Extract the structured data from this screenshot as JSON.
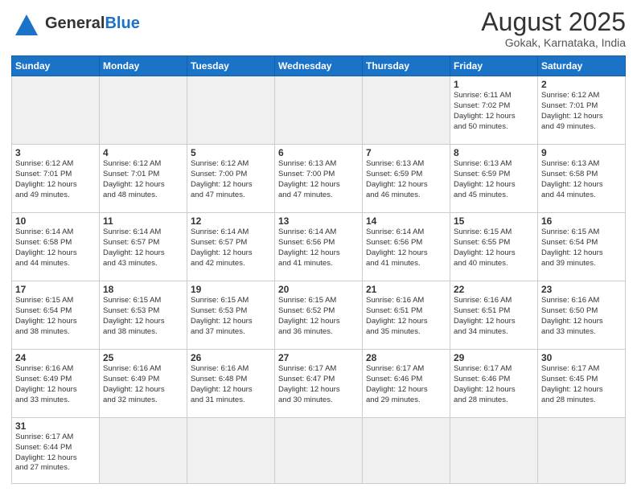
{
  "header": {
    "logo_general": "General",
    "logo_blue": "Blue",
    "title": "August 2025",
    "subtitle": "Gokak, Karnataka, India"
  },
  "weekdays": [
    "Sunday",
    "Monday",
    "Tuesday",
    "Wednesday",
    "Thursday",
    "Friday",
    "Saturday"
  ],
  "weeks": [
    [
      {
        "day": "",
        "info": ""
      },
      {
        "day": "",
        "info": ""
      },
      {
        "day": "",
        "info": ""
      },
      {
        "day": "",
        "info": ""
      },
      {
        "day": "",
        "info": ""
      },
      {
        "day": "1",
        "info": "Sunrise: 6:11 AM\nSunset: 7:02 PM\nDaylight: 12 hours\nand 50 minutes."
      },
      {
        "day": "2",
        "info": "Sunrise: 6:12 AM\nSunset: 7:01 PM\nDaylight: 12 hours\nand 49 minutes."
      }
    ],
    [
      {
        "day": "3",
        "info": "Sunrise: 6:12 AM\nSunset: 7:01 PM\nDaylight: 12 hours\nand 49 minutes."
      },
      {
        "day": "4",
        "info": "Sunrise: 6:12 AM\nSunset: 7:01 PM\nDaylight: 12 hours\nand 48 minutes."
      },
      {
        "day": "5",
        "info": "Sunrise: 6:12 AM\nSunset: 7:00 PM\nDaylight: 12 hours\nand 47 minutes."
      },
      {
        "day": "6",
        "info": "Sunrise: 6:13 AM\nSunset: 7:00 PM\nDaylight: 12 hours\nand 47 minutes."
      },
      {
        "day": "7",
        "info": "Sunrise: 6:13 AM\nSunset: 6:59 PM\nDaylight: 12 hours\nand 46 minutes."
      },
      {
        "day": "8",
        "info": "Sunrise: 6:13 AM\nSunset: 6:59 PM\nDaylight: 12 hours\nand 45 minutes."
      },
      {
        "day": "9",
        "info": "Sunrise: 6:13 AM\nSunset: 6:58 PM\nDaylight: 12 hours\nand 44 minutes."
      }
    ],
    [
      {
        "day": "10",
        "info": "Sunrise: 6:14 AM\nSunset: 6:58 PM\nDaylight: 12 hours\nand 44 minutes."
      },
      {
        "day": "11",
        "info": "Sunrise: 6:14 AM\nSunset: 6:57 PM\nDaylight: 12 hours\nand 43 minutes."
      },
      {
        "day": "12",
        "info": "Sunrise: 6:14 AM\nSunset: 6:57 PM\nDaylight: 12 hours\nand 42 minutes."
      },
      {
        "day": "13",
        "info": "Sunrise: 6:14 AM\nSunset: 6:56 PM\nDaylight: 12 hours\nand 41 minutes."
      },
      {
        "day": "14",
        "info": "Sunrise: 6:14 AM\nSunset: 6:56 PM\nDaylight: 12 hours\nand 41 minutes."
      },
      {
        "day": "15",
        "info": "Sunrise: 6:15 AM\nSunset: 6:55 PM\nDaylight: 12 hours\nand 40 minutes."
      },
      {
        "day": "16",
        "info": "Sunrise: 6:15 AM\nSunset: 6:54 PM\nDaylight: 12 hours\nand 39 minutes."
      }
    ],
    [
      {
        "day": "17",
        "info": "Sunrise: 6:15 AM\nSunset: 6:54 PM\nDaylight: 12 hours\nand 38 minutes."
      },
      {
        "day": "18",
        "info": "Sunrise: 6:15 AM\nSunset: 6:53 PM\nDaylight: 12 hours\nand 38 minutes."
      },
      {
        "day": "19",
        "info": "Sunrise: 6:15 AM\nSunset: 6:53 PM\nDaylight: 12 hours\nand 37 minutes."
      },
      {
        "day": "20",
        "info": "Sunrise: 6:15 AM\nSunset: 6:52 PM\nDaylight: 12 hours\nand 36 minutes."
      },
      {
        "day": "21",
        "info": "Sunrise: 6:16 AM\nSunset: 6:51 PM\nDaylight: 12 hours\nand 35 minutes."
      },
      {
        "day": "22",
        "info": "Sunrise: 6:16 AM\nSunset: 6:51 PM\nDaylight: 12 hours\nand 34 minutes."
      },
      {
        "day": "23",
        "info": "Sunrise: 6:16 AM\nSunset: 6:50 PM\nDaylight: 12 hours\nand 33 minutes."
      }
    ],
    [
      {
        "day": "24",
        "info": "Sunrise: 6:16 AM\nSunset: 6:49 PM\nDaylight: 12 hours\nand 33 minutes."
      },
      {
        "day": "25",
        "info": "Sunrise: 6:16 AM\nSunset: 6:49 PM\nDaylight: 12 hours\nand 32 minutes."
      },
      {
        "day": "26",
        "info": "Sunrise: 6:16 AM\nSunset: 6:48 PM\nDaylight: 12 hours\nand 31 minutes."
      },
      {
        "day": "27",
        "info": "Sunrise: 6:17 AM\nSunset: 6:47 PM\nDaylight: 12 hours\nand 30 minutes."
      },
      {
        "day": "28",
        "info": "Sunrise: 6:17 AM\nSunset: 6:46 PM\nDaylight: 12 hours\nand 29 minutes."
      },
      {
        "day": "29",
        "info": "Sunrise: 6:17 AM\nSunset: 6:46 PM\nDaylight: 12 hours\nand 28 minutes."
      },
      {
        "day": "30",
        "info": "Sunrise: 6:17 AM\nSunset: 6:45 PM\nDaylight: 12 hours\nand 28 minutes."
      }
    ],
    [
      {
        "day": "31",
        "info": "Sunrise: 6:17 AM\nSunset: 6:44 PM\nDaylight: 12 hours\nand 27 minutes."
      },
      {
        "day": "",
        "info": ""
      },
      {
        "day": "",
        "info": ""
      },
      {
        "day": "",
        "info": ""
      },
      {
        "day": "",
        "info": ""
      },
      {
        "day": "",
        "info": ""
      },
      {
        "day": "",
        "info": ""
      }
    ]
  ]
}
